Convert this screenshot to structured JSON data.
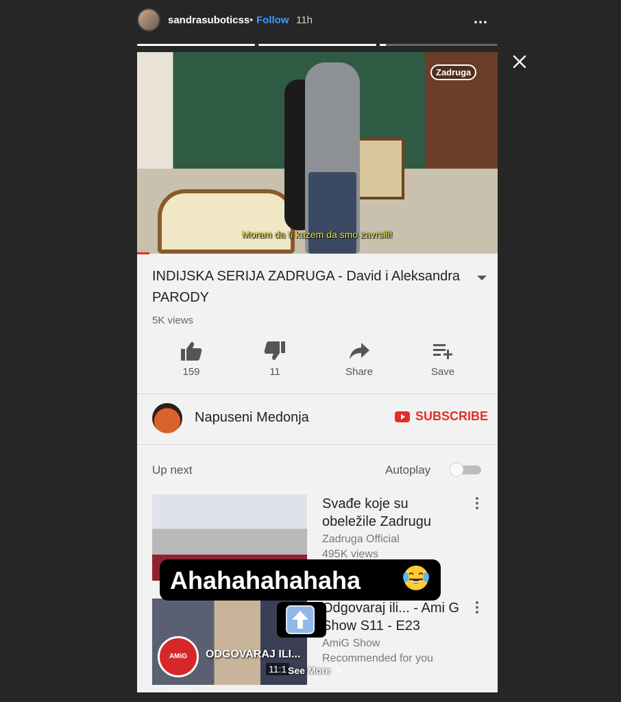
{
  "story": {
    "username": "sandrasuboticss",
    "separator": "•",
    "follow_label": "Follow",
    "time": "11h",
    "more_icon": "…",
    "progress": [
      1,
      1,
      0.05
    ]
  },
  "video": {
    "subtitle": "Moram da ti kazem da smo zavrsili!",
    "logo_text": "Zadruga",
    "title": "INDIJSKA SERIJA ZADRUGA - David i Aleksandra  PARODY",
    "views": "5K views",
    "actions": {
      "like_count": "159",
      "dislike_count": "11",
      "share_label": "Share",
      "save_label": "Save"
    }
  },
  "channel": {
    "name": "Napuseni Medonja",
    "subscribe_label": "SUBSCRIBE"
  },
  "up_next": {
    "label": "Up next",
    "autoplay_label": "Autoplay",
    "autoplay_on": false,
    "items": [
      {
        "title": "Svađe koje su obeležile Zadrugu",
        "channel": "Zadruga Official",
        "meta": "495K views"
      },
      {
        "title": "Odgovaraj ili... - Ami G Show S11 - E23",
        "channel": "AmiG Show",
        "meta": "Recommended for you",
        "thumb_text": "ODGOVARAJ ILI...",
        "logo_text": "AMiG SHOW",
        "duration": "11:1"
      }
    ]
  },
  "sticker": {
    "text": "Ahahahahahaha",
    "emoji": "tears-of-joy-emoji",
    "arrow": "up-arrow-icon"
  },
  "see_more": "See More",
  "colors": {
    "accent": "#e52d27",
    "follow": "#3e9bff",
    "subtitle": "#f4e94a"
  }
}
